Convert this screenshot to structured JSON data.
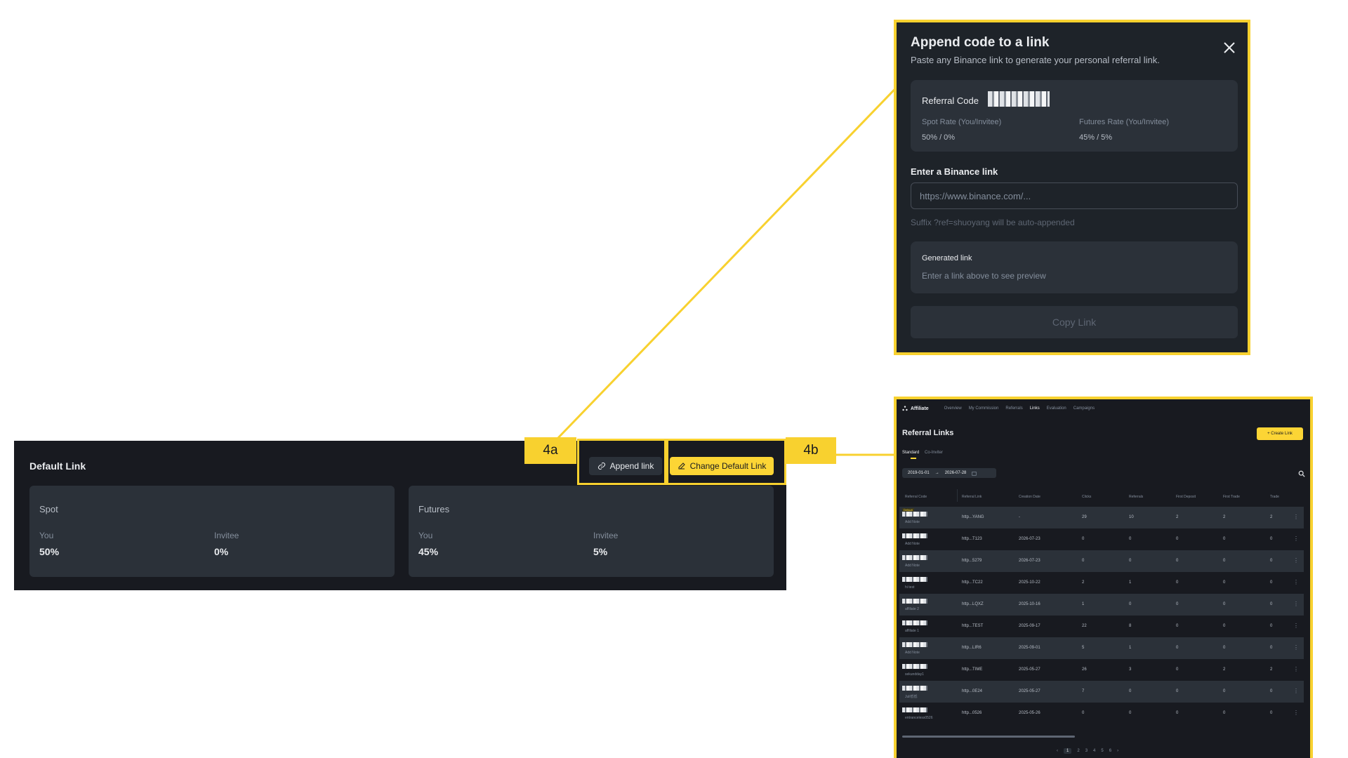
{
  "panel": {
    "title": "Default Link",
    "append_label": "Append link",
    "change_label": "Change Default Link",
    "tag_a": "4a",
    "tag_b": "4b",
    "spot": {
      "name": "Spot",
      "you_label": "You",
      "you_value": "50%",
      "invitee_label": "Invitee",
      "invitee_value": "0%"
    },
    "futures": {
      "name": "Futures",
      "you_label": "You",
      "you_value": "45%",
      "invitee_label": "Invitee",
      "invitee_value": "5%"
    }
  },
  "modal": {
    "title": "Append code to a link",
    "subtitle": "Paste any Binance link to generate your personal referral link.",
    "referral_code_label": "Referral Code",
    "spot_rate_label": "Spot Rate (You/Invitee)",
    "spot_rate_value": "50% / 0%",
    "futures_rate_label": "Futures Rate (You/Invitee)",
    "futures_rate_value": "45% / 5%",
    "enter_label": "Enter a Binance link",
    "input_placeholder": "https://www.binance.com/...",
    "suffix_note": "Suffix ?ref=shuoyang will be auto-appended",
    "generated_label": "Generated link",
    "generated_preview": "Enter a link above to see preview",
    "copy_label": "Copy Link"
  },
  "links_page": {
    "brand": "Affiliate",
    "nav": [
      "Overview",
      "My Commission",
      "Referrals",
      "Links",
      "Evaluation",
      "Campaigns"
    ],
    "active_nav": "Links",
    "title": "Referral Links",
    "create_label": "+ Create Link",
    "tabs": [
      "Standard",
      "Co-Inviter"
    ],
    "date_from": "2019-01-01",
    "date_to": "2026-07-28",
    "headers": [
      "Referral Code",
      "Referral Link",
      "Creation Date",
      "Clicks",
      "Referrals",
      "First Deposit",
      "First Trade",
      "Trade"
    ],
    "rows": [
      {
        "badge": "Default",
        "note": "Add Note",
        "link": "http...YANG",
        "date": "-",
        "clicks": "29",
        "referrals": "10",
        "deposit": "2",
        "trade1": "2",
        "trade": "2"
      },
      {
        "badge": "",
        "note": "Add Note",
        "link": "http...T123",
        "date": "2026-07-23",
        "clicks": "0",
        "referrals": "0",
        "deposit": "0",
        "trade1": "0",
        "trade": "0"
      },
      {
        "badge": "",
        "note": "Add Note",
        "link": "http...5279",
        "date": "2026-07-23",
        "clicks": "0",
        "referrals": "0",
        "deposit": "0",
        "trade1": "0",
        "trade": "0"
      },
      {
        "badge": "",
        "note": "hi test",
        "link": "http...TC22",
        "date": "2025-10-22",
        "clicks": "2",
        "referrals": "1",
        "deposit": "0",
        "trade1": "0",
        "trade": "0"
      },
      {
        "badge": "",
        "note": "affiliate 2",
        "link": "http...LQXZ",
        "date": "2025-10-16",
        "clicks": "1",
        "referrals": "0",
        "deposit": "0",
        "trade1": "0",
        "trade": "0"
      },
      {
        "badge": "",
        "note": "affiliate 1",
        "link": "http...TEST",
        "date": "2025-09-17",
        "clicks": "22",
        "referrals": "8",
        "deposit": "0",
        "trade1": "0",
        "trade": "0"
      },
      {
        "badge": "",
        "note": "Add Note",
        "link": "http...LIR6",
        "date": "2025-09-01",
        "clicks": "5",
        "referrals": "1",
        "deposit": "0",
        "trade1": "0",
        "trade": "0"
      },
      {
        "badge": "",
        "note": "sekundday1",
        "link": "http...TIME",
        "date": "2025-05-27",
        "clicks": "26",
        "referrals": "3",
        "deposit": "0",
        "trade1": "2",
        "trade": "2"
      },
      {
        "badge": "",
        "note": "Juli低低",
        "link": "http...0E24",
        "date": "2025-05-27",
        "clicks": "7",
        "referrals": "0",
        "deposit": "0",
        "trade1": "0",
        "trade": "0"
      },
      {
        "badge": "",
        "note": "entranceless0526",
        "link": "http...0526",
        "date": "2025-05-26",
        "clicks": "0",
        "referrals": "0",
        "deposit": "0",
        "trade1": "0",
        "trade": "0"
      }
    ],
    "pages": [
      "1",
      "2",
      "3",
      "4",
      "5",
      "6"
    ],
    "current_page": "1"
  },
  "colors": {
    "accent": "#f8d12f",
    "bg_dark": "#181a20",
    "card": "#2b3139"
  },
  "icons": [
    "link-icon",
    "edit-icon",
    "close-icon",
    "search-icon",
    "calendar-icon",
    "kebab-menu-icon"
  ]
}
